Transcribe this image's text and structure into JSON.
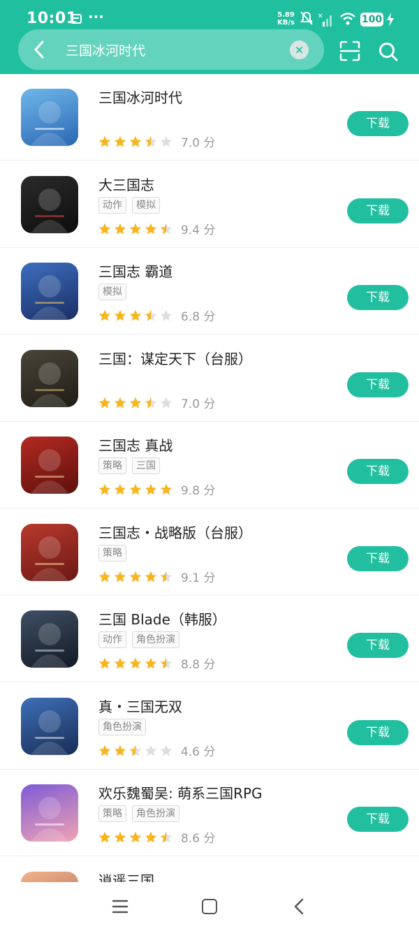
{
  "status_bar": {
    "time": "10:01",
    "dots": "···",
    "net_speed_value": "5.89",
    "net_speed_unit": "KB/s",
    "battery": "100"
  },
  "search": {
    "query": "三国冰河时代"
  },
  "colors": {
    "header": "#1fbf9f",
    "button": "#21bf9f",
    "star": "#f8b51d",
    "star_empty": "#dedede"
  },
  "apps": [
    {
      "name": "三国冰河时代",
      "tags": [],
      "stars": 3.5,
      "score": "7.0 分",
      "button": "下载"
    },
    {
      "name": "大三国志",
      "tags": [
        "动作",
        "模拟"
      ],
      "stars": 4.5,
      "score": "9.4 分",
      "button": "下载"
    },
    {
      "name": "三国志 霸道",
      "tags": [
        "模拟"
      ],
      "stars": 3.5,
      "score": "6.8 分",
      "button": "下载"
    },
    {
      "name": "三国：谋定天下（台服）",
      "tags": [],
      "stars": 3.5,
      "score": "7.0 分",
      "button": "下载"
    },
    {
      "name": "三国志 真战",
      "tags": [
        "策略",
        "三国"
      ],
      "stars": 5,
      "score": "9.8 分",
      "button": "下载"
    },
    {
      "name": "三国志・战略版（台服）",
      "tags": [
        "策略"
      ],
      "stars": 4.5,
      "score": "9.1 分",
      "button": "下载"
    },
    {
      "name": "三国 Blade（韩服）",
      "tags": [
        "动作",
        "角色扮演"
      ],
      "stars": 4.5,
      "score": "8.8 分",
      "button": "下载"
    },
    {
      "name": "真・三国无双",
      "tags": [
        "角色扮演"
      ],
      "stars": 2.5,
      "score": "4.6 分",
      "button": "下载"
    },
    {
      "name": "欢乐魏蜀吴: 萌系三国RPG",
      "tags": [
        "策略",
        "角色扮演"
      ],
      "stars": 4.5,
      "score": "8.6 分",
      "button": "下载"
    },
    {
      "name": "逍遥三国",
      "tags": [],
      "stars": 0,
      "score": "",
      "button": ""
    }
  ],
  "icons": {
    "back": "back-arrow-icon",
    "clear": "clear-icon",
    "scan": "scan-icon",
    "search": "search-icon",
    "nav_menu": "menu-icon",
    "nav_home": "home-icon",
    "nav_back": "back-icon"
  }
}
